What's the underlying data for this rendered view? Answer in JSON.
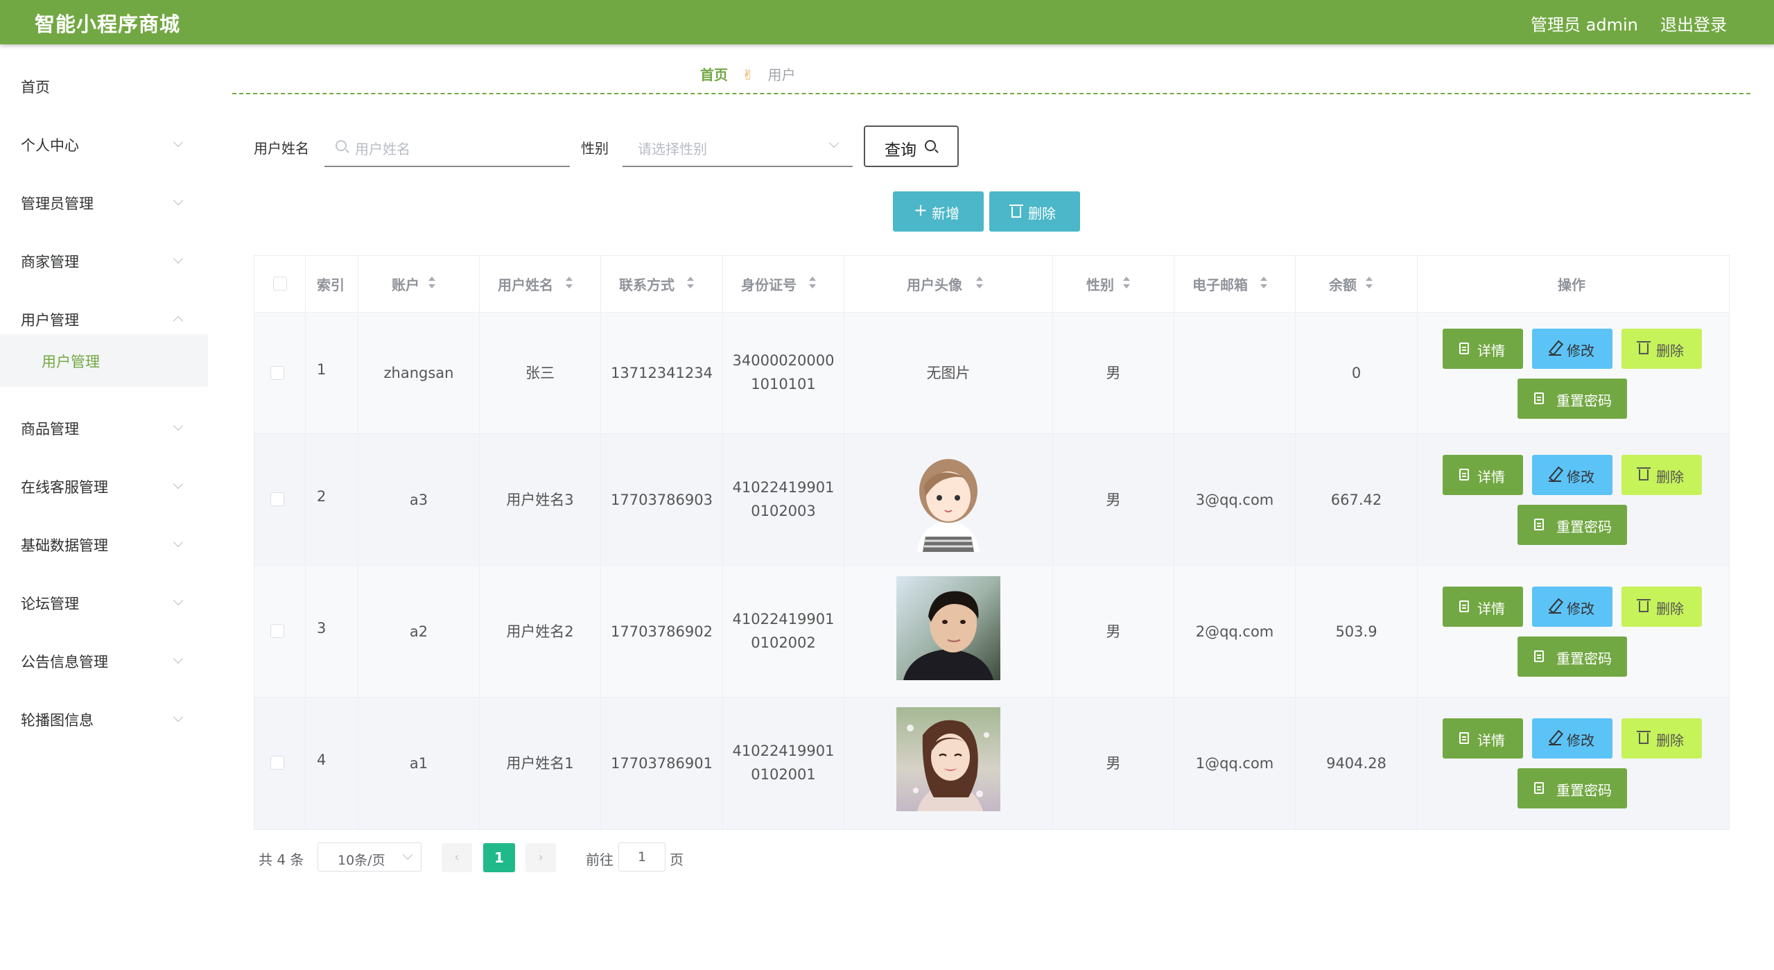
{
  "header": {
    "title": "智能小程序商城",
    "user": "管理员 admin",
    "logout": "退出登录"
  },
  "sidebar": {
    "items": [
      {
        "label": "首页",
        "chevron": false
      },
      {
        "label": "个人中心",
        "chevron": true
      },
      {
        "label": "管理员管理",
        "chevron": true
      },
      {
        "label": "商家管理",
        "chevron": true
      },
      {
        "label": "用户管理",
        "chevron": true,
        "expanded": true
      },
      {
        "label": "商品管理",
        "chevron": true
      },
      {
        "label": "在线客服管理",
        "chevron": true
      },
      {
        "label": "基础数据管理",
        "chevron": true
      },
      {
        "label": "论坛管理",
        "chevron": true
      },
      {
        "label": "公告信息管理",
        "chevron": true
      },
      {
        "label": "轮播图信息",
        "chevron": true
      }
    ],
    "active_sub": "用户管理"
  },
  "breadcrumb": {
    "home": "首页",
    "separator": "✌",
    "current": "用户"
  },
  "search": {
    "name_label": "用户姓名",
    "name_placeholder": "用户姓名",
    "gender_label": "性别",
    "gender_placeholder": "请选择性别",
    "query_label": "查询"
  },
  "actions": {
    "add_label": "新增",
    "delete_label": "删除"
  },
  "table": {
    "headers": {
      "index": "索引",
      "account": "账户",
      "name": "用户姓名",
      "phone": "联系方式",
      "id_card": "身份证号",
      "avatar": "用户头像",
      "gender": "性别",
      "email": "电子邮箱",
      "balance": "余额",
      "ops": "操作"
    },
    "rows": [
      {
        "index": "1",
        "account": "zhangsan",
        "name": "张三",
        "phone": "13712341234",
        "id_line1": "34000020000",
        "id_line2": "1010101",
        "avatar_text": "无图片",
        "avatar": "none",
        "gender": "男",
        "email": "",
        "balance": "0"
      },
      {
        "index": "2",
        "account": "a3",
        "name": "用户姓名3",
        "phone": "17703786903",
        "id_line1": "41022419901",
        "id_line2": "0102003",
        "avatar_text": "",
        "avatar": "cartoon-girl",
        "gender": "男",
        "email": "3@qq.com",
        "balance": "667.42"
      },
      {
        "index": "3",
        "account": "a2",
        "name": "用户姓名2",
        "phone": "17703786902",
        "id_line1": "41022419901",
        "id_line2": "0102002",
        "avatar_text": "",
        "avatar": "man-photo",
        "gender": "男",
        "email": "2@qq.com",
        "balance": "503.9"
      },
      {
        "index": "4",
        "account": "a1",
        "name": "用户姓名1",
        "phone": "17703786901",
        "id_line1": "41022419901",
        "id_line2": "0102001",
        "avatar_text": "",
        "avatar": "woman-photo",
        "gender": "男",
        "email": "1@qq.com",
        "balance": "9404.28"
      }
    ],
    "row_buttons": {
      "detail": "详情",
      "edit": "修改",
      "delete": "删除",
      "reset": "重置密码"
    }
  },
  "pagination": {
    "total": "共 4 条",
    "page_size": "10条/页",
    "prev": "‹",
    "next": "›",
    "current_page": "1",
    "goto_label": "前往",
    "goto_value": "1",
    "page_suffix": "页"
  },
  "colors": {
    "brand": "#72a843",
    "add_button": "#4bb7c8",
    "edit_button": "#5cc3f7",
    "delete_button": "#c6f25a",
    "pagination_active": "#20b98a"
  }
}
